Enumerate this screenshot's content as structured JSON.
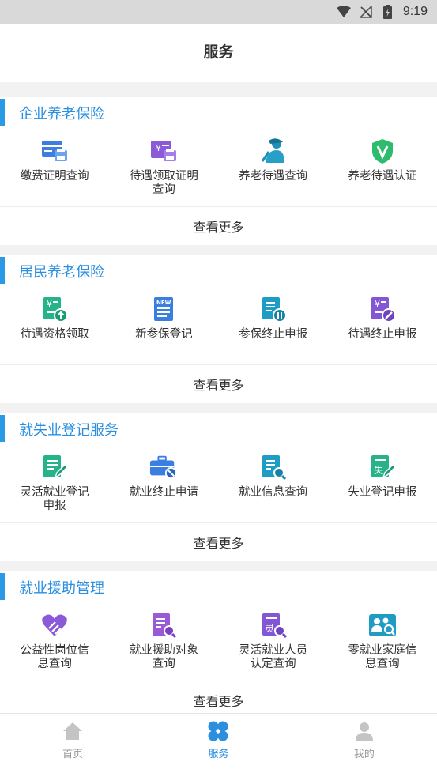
{
  "status_bar": {
    "time": "9:19"
  },
  "header": {
    "title": "服务"
  },
  "sections": [
    {
      "title": "企业养老保险",
      "more": "查看更多",
      "items": [
        {
          "label": "缴费证明查询",
          "icon": "payment-certificate-icon"
        },
        {
          "label": "待遇领取证明查询",
          "icon": "benefit-receipt-certificate-icon"
        },
        {
          "label": "养老待遇查询",
          "icon": "pension-benefit-query-icon"
        },
        {
          "label": "养老待遇认证",
          "icon": "pension-benefit-verification-icon"
        }
      ]
    },
    {
      "title": "居民养老保险",
      "more": "查看更多",
      "items": [
        {
          "label": "待遇资格领取",
          "icon": "benefit-eligibility-icon"
        },
        {
          "label": "新参保登记",
          "icon": "new-enrollment-icon"
        },
        {
          "label": "参保终止申报",
          "icon": "enrollment-termination-icon"
        },
        {
          "label": "待遇终止申报",
          "icon": "benefit-termination-icon"
        }
      ]
    },
    {
      "title": "就失业登记服务",
      "more": "查看更多",
      "items": [
        {
          "label": "灵活就业登记申报",
          "icon": "flexible-employment-registration-icon"
        },
        {
          "label": "就业终止申请",
          "icon": "employment-termination-icon"
        },
        {
          "label": "就业信息查询",
          "icon": "employment-info-query-icon"
        },
        {
          "label": "失业登记申报",
          "icon": "unemployment-registration-icon"
        }
      ]
    },
    {
      "title": "就业援助管理",
      "more": "查看更多",
      "items": [
        {
          "label": "公益性岗位信息查询",
          "icon": "public-welfare-post-icon"
        },
        {
          "label": "就业援助对象查询",
          "icon": "employment-aid-target-icon"
        },
        {
          "label": "灵活就业人员认定查询",
          "icon": "flexible-worker-identification-icon"
        },
        {
          "label": "零就业家庭信息查询",
          "icon": "zero-employment-family-icon"
        }
      ]
    }
  ],
  "tabbar": [
    {
      "label": "首页",
      "icon": "home-icon",
      "active": false
    },
    {
      "label": "服务",
      "icon": "services-icon",
      "active": true
    },
    {
      "label": "我的",
      "icon": "profile-icon",
      "active": false
    }
  ],
  "colors": {
    "accent": "#2b8fe0",
    "inactive": "#999999"
  }
}
